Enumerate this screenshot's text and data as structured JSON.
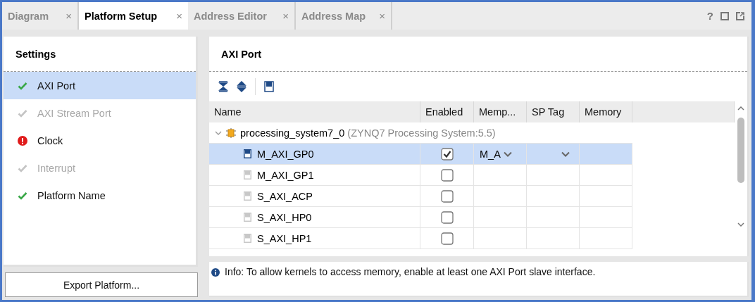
{
  "tabs": [
    {
      "label": "Diagram",
      "selected": false,
      "close": "×"
    },
    {
      "label": "Platform Setup",
      "selected": true,
      "close": "×"
    },
    {
      "label": "Address Editor",
      "selected": false,
      "close": "×"
    },
    {
      "label": "Address Map",
      "selected": false,
      "close": "×"
    }
  ],
  "window_controls": {
    "help": "?"
  },
  "settings": {
    "title": "Settings",
    "items": [
      {
        "label": "AXI Port",
        "kind": "check",
        "disabled": false,
        "selected": true
      },
      {
        "label": "AXI Stream Port",
        "kind": "check",
        "disabled": true,
        "selected": false
      },
      {
        "label": "Clock",
        "kind": "error",
        "disabled": false,
        "selected": false
      },
      {
        "label": "Interrupt",
        "kind": "check",
        "disabled": true,
        "selected": false
      },
      {
        "label": "Platform Name",
        "kind": "check",
        "disabled": false,
        "selected": false
      }
    ],
    "export_button": "Export Platform..."
  },
  "axi_port": {
    "title": "AXI Port",
    "table": {
      "columns": [
        "Name",
        "Enabled",
        "Memp...",
        "SP Tag",
        "Memory"
      ],
      "tree": {
        "name": "processing_system7_0",
        "detail": "(ZYNQ7 Processing System:5.5)",
        "expanded": true,
        "children": [
          {
            "name": "M_AXI_GP0",
            "enabled": true,
            "selected": true,
            "memport": "M_A",
            "dropdowns": true
          },
          {
            "name": "M_AXI_GP1",
            "enabled": false,
            "selected": false,
            "dropdowns": false
          },
          {
            "name": "S_AXI_ACP",
            "enabled": false,
            "selected": false,
            "dropdowns": false
          },
          {
            "name": "S_AXI_HP0",
            "enabled": false,
            "selected": false,
            "dropdowns": false
          },
          {
            "name": "S_AXI_HP1",
            "enabled": false,
            "selected": false,
            "dropdowns": false
          }
        ]
      }
    }
  },
  "info": "Info: To allow kernels to access memory, enable at least one AXI Port slave interface."
}
